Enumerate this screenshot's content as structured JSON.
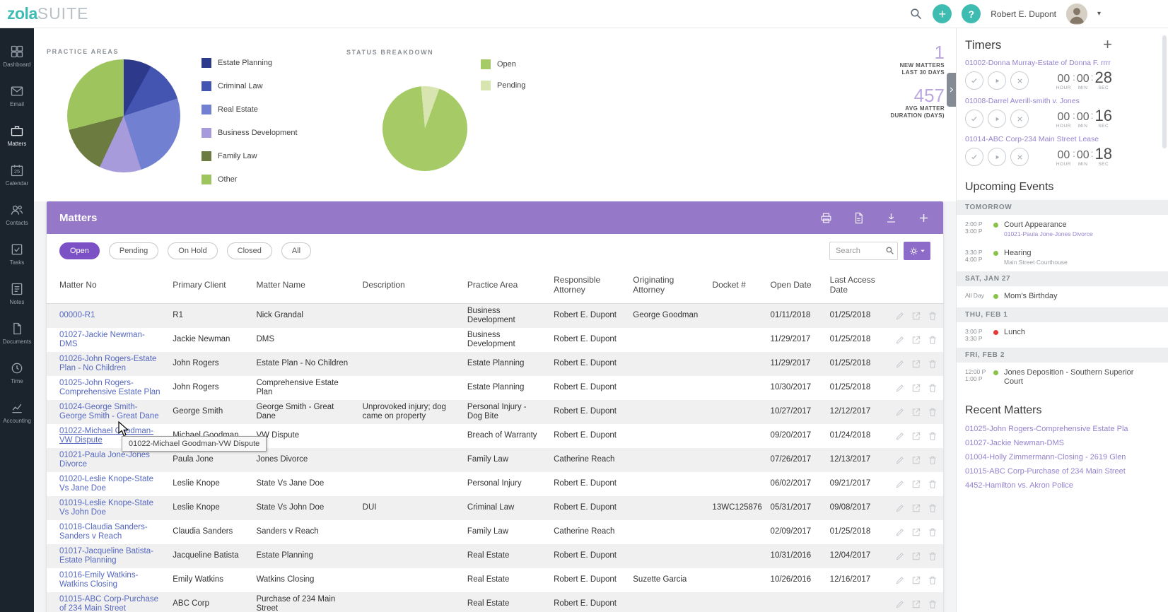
{
  "brand": {
    "primary": "zola",
    "secondary": "SUITE"
  },
  "topbar": {
    "user": "Robert E. Dupont",
    "add_label": "+",
    "help_label": "?"
  },
  "sidebar": {
    "items": [
      {
        "label": "Dashboard"
      },
      {
        "label": "Email"
      },
      {
        "label": "Matters"
      },
      {
        "label": "Calendar",
        "badge": "25"
      },
      {
        "label": "Contacts"
      },
      {
        "label": "Tasks"
      },
      {
        "label": "Notes"
      },
      {
        "label": "Documents"
      },
      {
        "label": "Time"
      },
      {
        "label": "Accounting"
      }
    ]
  },
  "charts": {
    "practice_title": "PRACTICE AREAS",
    "status_title": "STATUS BREAKDOWN",
    "stats": [
      {
        "value": "1",
        "line1": "NEW MATTERS",
        "line2": "LAST 30 DAYS"
      },
      {
        "value": "457",
        "line1": "AVG MATTER",
        "line2": "DURATION (DAYS)"
      }
    ]
  },
  "chart_data": [
    {
      "id": "practice-areas",
      "type": "pie",
      "title": "Practice Areas",
      "rotate": 0,
      "slices": [
        {
          "label": "Estate Planning",
          "value": 8,
          "color": "#2D3A8C"
        },
        {
          "label": "Criminal Law",
          "value": 12,
          "color": "#4355B0"
        },
        {
          "label": "Real Estate",
          "value": 25,
          "color": "#7280D2"
        },
        {
          "label": "Business Development",
          "value": 12,
          "color": "#A89BDB"
        },
        {
          "label": "Family Law",
          "value": 14,
          "color": "#6C7B3F"
        },
        {
          "label": "Other",
          "value": 29,
          "color": "#9EC45E"
        }
      ]
    },
    {
      "id": "status-breakdown",
      "type": "pie",
      "title": "Status Breakdown",
      "rotate": 20,
      "slices": [
        {
          "label": "Open",
          "value": 93,
          "color": "#A6CB66"
        },
        {
          "label": "Pending",
          "value": 7,
          "color": "#D9E5B0"
        }
      ]
    }
  ],
  "matters": {
    "title": "Matters",
    "filters": [
      {
        "label": "Open",
        "cls": "active"
      },
      {
        "label": "Pending"
      },
      {
        "label": "On Hold"
      },
      {
        "label": "Closed"
      },
      {
        "label": "All"
      }
    ],
    "search_placeholder": "Search",
    "columns": [
      "Matter No",
      "Primary Client",
      "Matter Name",
      "Description",
      "Practice Area",
      "Responsible Attorney",
      "Originating Attorney",
      "Docket #",
      "Open Date",
      "Last Access Date",
      ""
    ],
    "tooltip": "01022-Michael Goodman-VW Dispute",
    "rows": [
      {
        "no": "00000-R1",
        "client": "R1",
        "name": "Nick Grandal",
        "desc": "",
        "practice": "Business Development",
        "resp": "Robert E. Dupont",
        "orig": "George Goodman",
        "docket": "",
        "open": "01/11/2018",
        "access": "01/25/2018"
      },
      {
        "no": "01027-Jackie Newman-DMS",
        "client": "Jackie Newman",
        "name": "DMS",
        "desc": "",
        "practice": "Business Development",
        "resp": "Robert E. Dupont",
        "orig": "",
        "docket": "",
        "open": "11/29/2017",
        "access": "01/25/2018"
      },
      {
        "no": "01026-John Rogers-Estate Plan - No Children",
        "client": "John Rogers",
        "name": "Estate Plan - No Children",
        "desc": "",
        "practice": "Estate Planning",
        "resp": "Robert E. Dupont",
        "orig": "",
        "docket": "",
        "open": "11/29/2017",
        "access": "01/25/2018"
      },
      {
        "no": "01025-John Rogers-Comprehensive Estate Plan",
        "client": "John Rogers",
        "name": "Comprehensive Estate Plan",
        "desc": "",
        "practice": "Estate Planning",
        "resp": "Robert E. Dupont",
        "orig": "",
        "docket": "",
        "open": "10/30/2017",
        "access": "01/25/2018"
      },
      {
        "no": "01024-George Smith-George Smith - Great Dane",
        "client": "George Smith",
        "name": "George Smith - Great Dane",
        "desc": "Unprovoked injury; dog came on property",
        "practice": "Personal Injury - Dog Bite",
        "resp": "Robert E. Dupont",
        "orig": "",
        "docket": "",
        "open": "10/27/2017",
        "access": "12/12/2017"
      },
      {
        "no": "01022-Michael Goodman-VW Dispute",
        "client": "Michael Goodman",
        "name": "VW Dispute",
        "desc": "",
        "practice": "Breach of Warranty",
        "resp": "Robert E. Dupont",
        "orig": "",
        "docket": "",
        "open": "09/20/2017",
        "access": "01/24/2018",
        "cls": "hovered"
      },
      {
        "no": "01021-Paula Jone-Jones Divorce",
        "client": "Paula Jone",
        "name": "Jones Divorce",
        "desc": "",
        "practice": "Family Law",
        "resp": "Catherine Reach",
        "orig": "",
        "docket": "",
        "open": "07/26/2017",
        "access": "12/13/2017"
      },
      {
        "no": "01020-Leslie Knope-State Vs Jane Doe",
        "client": "Leslie Knope",
        "name": "State Vs Jane Doe",
        "desc": "",
        "practice": "Personal Injury",
        "resp": "Robert E. Dupont",
        "orig": "",
        "docket": "",
        "open": "06/02/2017",
        "access": "09/21/2017"
      },
      {
        "no": "01019-Leslie Knope-State Vs John Doe",
        "client": "Leslie Knope",
        "name": "State Vs John Doe",
        "desc": "DUI",
        "practice": "Criminal Law",
        "resp": "Robert E. Dupont",
        "orig": "",
        "docket": "13WC125876",
        "open": "05/31/2017",
        "access": "09/08/2017"
      },
      {
        "no": "01018-Claudia Sanders-Sanders v Reach",
        "client": "Claudia Sanders",
        "name": "Sanders v Reach",
        "desc": "",
        "practice": "Family Law",
        "resp": "Catherine Reach",
        "orig": "",
        "docket": "",
        "open": "02/09/2017",
        "access": "01/25/2018"
      },
      {
        "no": "01017-Jacqueline Batista-Estate Planning",
        "client": "Jacqueline Batista",
        "name": "Estate Planning",
        "desc": "",
        "practice": "Real Estate",
        "resp": "Robert E. Dupont",
        "orig": "",
        "docket": "",
        "open": "10/31/2016",
        "access": "12/04/2017"
      },
      {
        "no": "01016-Emily Watkins-Watkins Closing",
        "client": "Emily Watkins",
        "name": "Watkins Closing",
        "desc": "",
        "practice": "Real Estate",
        "resp": "Robert E. Dupont",
        "orig": "Suzette Garcia",
        "docket": "",
        "open": "10/26/2016",
        "access": "12/16/2017"
      },
      {
        "no": "01015-ABC Corp-Purchase of 234 Main Street",
        "client": "ABC Corp",
        "name": "Purchase of 234 Main Street",
        "desc": "",
        "practice": "Real Estate",
        "resp": "Robert E. Dupont",
        "orig": "",
        "docket": "",
        "open": "",
        "access": ""
      }
    ]
  },
  "timers": {
    "title": "Timers",
    "add_label": "+",
    "units": {
      "h": "HOUR",
      "m": "MIN",
      "s": "SEC"
    },
    "items": [
      {
        "matter": "01002-Donna Murray-Estate of Donna F. rrrr",
        "hour": "00",
        "min": "00",
        "sec": "28"
      },
      {
        "matter": "01008-Darrel Averill-smith v. Jones",
        "hour": "00",
        "min": "00",
        "sec": "16"
      },
      {
        "matter": "01014-ABC Corp-234 Main Street Lease",
        "hour": "00",
        "min": "00",
        "sec": "18"
      }
    ]
  },
  "events": {
    "title": "Upcoming Events",
    "items": [
      {
        "type": "header",
        "label": "TOMORROW"
      },
      {
        "type": "event",
        "start": "2:00 P",
        "end": "3:00 P",
        "dot": "#8BC34A",
        "title": "Court Appearance",
        "subtitle": "01021-Paula Jone-Jones Divorce",
        "subtitle_style": "link"
      },
      {
        "type": "event",
        "start": "3:30 P",
        "end": "4:00 P",
        "dot": "#8BC34A",
        "title": "Hearing",
        "subtitle": "Main Street Courthouse",
        "subtitle_style": "muted"
      },
      {
        "type": "header",
        "label": "SAT, JAN 27"
      },
      {
        "type": "event",
        "start": "All Day",
        "end": "",
        "dot": "#8BC34A",
        "title": "Mom's Birthday",
        "subtitle": "",
        "subtitle_style": "muted"
      },
      {
        "type": "header",
        "label": "THU, FEB 1"
      },
      {
        "type": "event",
        "start": "3:00 P",
        "end": "3:30 P",
        "dot": "#E53935",
        "title": "Lunch",
        "subtitle": "",
        "subtitle_style": "muted"
      },
      {
        "type": "header",
        "label": "FRI, FEB 2"
      },
      {
        "type": "event",
        "start": "12:00 P",
        "end": "1:00 P",
        "dot": "#8BC34A",
        "title": "Jones Deposition - Southern Superior Court",
        "subtitle": "",
        "subtitle_style": "muted"
      }
    ]
  },
  "recent": {
    "title": "Recent Matters",
    "items": [
      "01025-John Rogers-Comprehensive Estate Pla",
      "01027-Jackie Newman-DMS",
      "01004-Holly Zimmermann-Closing - 2619 Glen",
      "01015-ABC Corp-Purchase of 234 Main Street",
      "4452-Hamilton vs. Akron Police"
    ]
  }
}
